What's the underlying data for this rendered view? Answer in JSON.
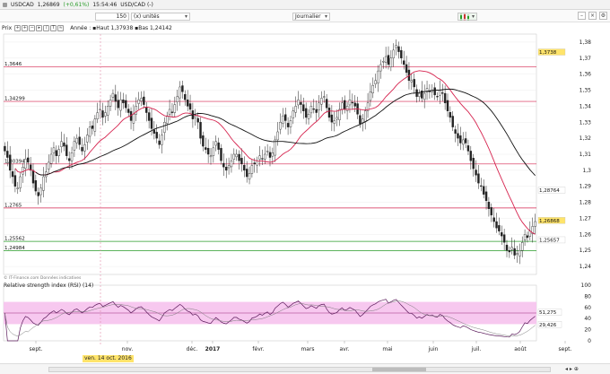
{
  "header": {
    "symbol": "USDCAD",
    "price": "1,26869",
    "change": "(+0,61%)",
    "time": "15:54:46",
    "description": "USD/CAD (-)"
  },
  "toolbar": {
    "count_value": "150",
    "units_label": "(x) unités",
    "period_label": "Journalier"
  },
  "price_panel": {
    "tool_label": "Prix",
    "legend": "Année : ▪Haut 1,37938 ▪Bas 1,24142",
    "credit": "© IT-Finance.com Données indicatives"
  },
  "chart_data": [
    {
      "type": "candlestick",
      "y_ticks": [
        "1,38",
        "1,37",
        "1,36",
        "1,35",
        "1,34",
        "1,33",
        "1,32",
        "1,31",
        "1,3",
        "1,29",
        "1,28",
        "1,27",
        "1,26",
        "1,25",
        "1,24"
      ],
      "ylim": [
        1.235,
        1.385
      ],
      "x_ticks": [
        "sept.",
        "nov.",
        "déc.",
        "2017",
        "févr.",
        "mars",
        "avr.",
        "mai",
        "juin",
        "juil.",
        "août",
        "sept."
      ],
      "cursor_date": "ven. 14 oct. 2016",
      "horizontal_levels": [
        {
          "label": "1,3646",
          "value": 1.3646
        },
        {
          "label": "1,34299",
          "value": 1.34299
        },
        {
          "label": "1,30394",
          "value": 1.30394
        },
        {
          "label": "1,2765",
          "value": 1.2765
        },
        {
          "label": "1,25562",
          "value": 1.25562
        },
        {
          "label": "1,24984",
          "value": 1.24984
        }
      ],
      "price_labels": [
        {
          "label": "1,3738",
          "value": 1.3738,
          "color": "#ffe46a"
        },
        {
          "label": "1,28764",
          "value": 1.28764,
          "color": "#ffffff"
        },
        {
          "label": "1,26868",
          "value": 1.26868,
          "color": "#ffe46a"
        },
        {
          "label": "1,25657",
          "value": 1.25657,
          "color": "#ffffff"
        }
      ],
      "close": [
        1.312,
        1.308,
        1.3,
        1.296,
        1.29,
        1.289,
        1.296,
        1.302,
        1.307,
        1.305,
        1.3,
        1.292,
        1.287,
        1.284,
        1.289,
        1.296,
        1.299,
        1.305,
        1.31,
        1.314,
        1.309,
        1.313,
        1.318,
        1.315,
        1.309,
        1.306,
        1.311,
        1.318,
        1.32,
        1.316,
        1.312,
        1.316,
        1.322,
        1.327,
        1.326,
        1.332,
        1.336,
        1.338,
        1.333,
        1.336,
        1.34,
        1.344,
        1.348,
        1.343,
        1.339,
        1.344,
        1.342,
        1.339,
        1.336,
        1.331,
        1.335,
        1.34,
        1.344,
        1.345,
        1.341,
        1.336,
        1.331,
        1.326,
        1.323,
        1.32,
        1.316,
        1.322,
        1.33,
        1.334,
        1.338,
        1.336,
        1.341,
        1.346,
        1.352,
        1.349,
        1.344,
        1.34,
        1.338,
        1.332,
        1.334,
        1.33,
        1.32,
        1.315,
        1.313,
        1.31,
        1.309,
        1.314,
        1.318,
        1.313,
        1.306,
        1.302,
        1.3,
        1.303,
        1.306,
        1.31,
        1.31,
        1.306,
        1.304,
        1.3,
        1.296,
        1.298,
        1.303,
        1.304,
        1.306,
        1.309,
        1.307,
        1.31,
        1.312,
        1.308,
        1.311,
        1.319,
        1.324,
        1.33,
        1.334,
        1.331,
        1.327,
        1.331,
        1.337,
        1.34,
        1.344,
        1.341,
        1.337,
        1.333,
        1.335,
        1.34,
        1.338,
        1.336,
        1.342,
        1.345,
        1.346,
        1.339,
        1.333,
        1.33,
        1.331,
        1.333,
        1.338,
        1.342,
        1.338,
        1.34,
        1.344,
        1.342,
        1.34,
        1.335,
        1.329,
        1.332,
        1.337,
        1.342,
        1.349,
        1.353,
        1.356,
        1.362,
        1.366,
        1.368,
        1.371,
        1.366,
        1.37,
        1.375,
        1.378,
        1.374,
        1.37,
        1.366,
        1.361,
        1.356,
        1.356,
        1.352,
        1.346,
        1.348,
        1.345,
        1.348,
        1.351,
        1.349,
        1.35,
        1.347,
        1.346,
        1.35,
        1.348,
        1.342,
        1.337,
        1.333,
        1.327,
        1.323,
        1.32,
        1.317,
        1.319,
        1.317,
        1.312,
        1.306,
        1.301,
        1.297,
        1.292,
        1.29,
        1.285,
        1.281,
        1.276,
        1.272,
        1.268,
        1.264,
        1.262,
        1.259,
        1.255,
        1.25,
        1.249,
        1.252,
        1.247,
        1.248,
        1.25,
        1.255,
        1.26,
        1.258,
        1.262,
        1.265,
        1.268
      ]
    },
    {
      "type": "line",
      "title": "Relative strength index (RSI) (14)",
      "y_ticks": [
        "100",
        "80",
        "60",
        "40",
        "20",
        "0"
      ],
      "ylim": [
        0,
        100
      ],
      "band": [
        30,
        70
      ],
      "value_labels": [
        {
          "label": "51,275",
          "value": 51.275
        },
        {
          "label": "29,426",
          "value": 29.426
        }
      ]
    }
  ]
}
